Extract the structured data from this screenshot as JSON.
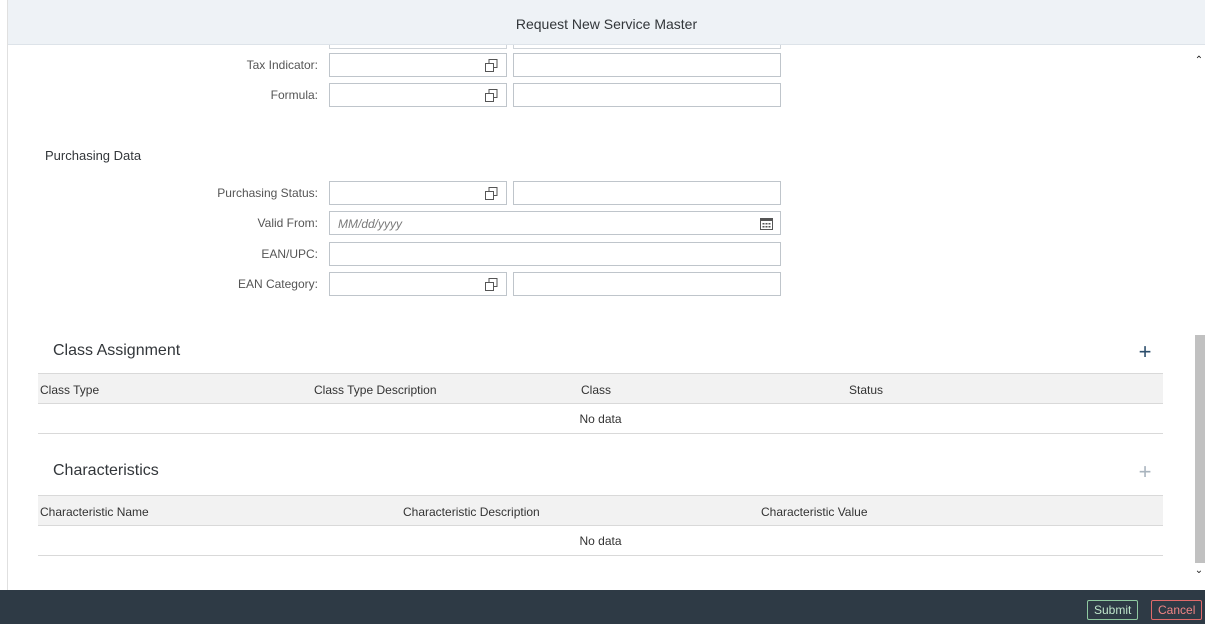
{
  "dialog": {
    "title": "Request New Service Master"
  },
  "basic_fields": [
    {
      "label": "Tax Indicator:",
      "value": "",
      "description": "",
      "icon": "value-help-icon"
    },
    {
      "label": "Formula:",
      "value": "",
      "description": "",
      "icon": "value-help-icon"
    }
  ],
  "purchasing": {
    "title": "Purchasing Data",
    "status": {
      "label": "Purchasing Status:",
      "value": "",
      "description": ""
    },
    "valid_from": {
      "label": "Valid From:",
      "placeholder": "MM/dd/yyyy",
      "value": ""
    },
    "ean_upc": {
      "label": "EAN/UPC:",
      "value": ""
    },
    "ean_category": {
      "label": "EAN Category:",
      "value": "",
      "description": ""
    }
  },
  "class_assignment": {
    "title": "Class Assignment",
    "add_icon": "+",
    "columns": [
      "Class Type",
      "Class Type Description",
      "Class",
      "Status"
    ],
    "rows": [],
    "empty_text": "No data"
  },
  "characteristics": {
    "title": "Characteristics",
    "add_icon": "+",
    "columns": [
      "Characteristic Name",
      "Characteristic Description",
      "Characteristic Value"
    ],
    "rows": [],
    "empty_text": "No data"
  },
  "footer": {
    "submit_label": "Submit",
    "cancel_label": "Cancel"
  },
  "colors": {
    "header_bg": "#eef2f6",
    "footer_bg": "#2e3a45",
    "accent": "#2c4e6c",
    "submit": "#8fc9a0",
    "cancel": "#e06a6a"
  }
}
